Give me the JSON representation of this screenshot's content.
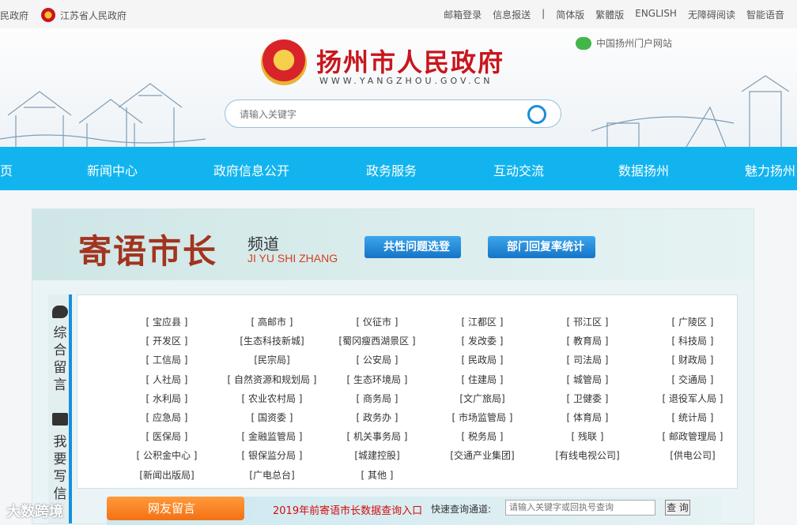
{
  "topbar": {
    "left_link": "民政府",
    "province": "江苏省人民政府",
    "links": [
      "邮箱登录",
      "信息报送",
      "|",
      "简体版",
      "繁體版",
      "ENGLISH",
      "无障碍阅读",
      "智能语音"
    ]
  },
  "header": {
    "title": "扬州市人民政府",
    "url": "WWW.YANGZHOU.GOV.CN",
    "portal": "中国扬州门户网站",
    "search_placeholder": "请输入关键字"
  },
  "nav": [
    "页",
    "新闻中心",
    "政府信息公开",
    "政务服务",
    "互动交流",
    "数据扬州",
    "魅力扬州"
  ],
  "banner": {
    "title": "寄语市长",
    "channel": "频道",
    "channel_en": "JI YU SHI ZHANG",
    "btn1": "共性问题选登",
    "btn2": "部门回复率统计"
  },
  "side": {
    "tab1": "综合留言",
    "tab2": "我要写信"
  },
  "departments": [
    [
      "[ 宝应县 ]",
      "[ 高邮市 ]",
      "[ 仪征市 ]",
      "[ 江都区 ]",
      "[ 邗江区 ]",
      "[ 广陵区 ]"
    ],
    [
      "[ 开发区 ]",
      "[生态科技新城]",
      "[蜀冈瘦西湖景区 ]",
      "[ 发改委 ]",
      "[ 教育局 ]",
      "[ 科技局 ]"
    ],
    [
      "[ 工信局 ]",
      "[民宗局]",
      "[ 公安局 ]",
      "[ 民政局 ]",
      "[ 司法局 ]",
      "[ 财政局 ]"
    ],
    [
      "[ 人社局 ]",
      "[ 自然资源和规划局 ]",
      "[ 生态环境局 ]",
      "[ 住建局 ]",
      "[ 城管局 ]",
      "[ 交通局 ]"
    ],
    [
      "[ 水利局 ]",
      "[ 农业农村局 ]",
      "[ 商务局 ]",
      "[文广旅局]",
      "[ 卫健委 ]",
      "[ 退役军人局 ]"
    ],
    [
      "[ 应急局 ]",
      "[ 国资委 ]",
      "[ 政务办 ]",
      "[ 市场监管局 ]",
      "[ 体育局 ]",
      "[ 统计局 ]"
    ],
    [
      "[ 医保局 ]",
      "[ 金融监管局 ]",
      "[ 机关事务局 ]",
      "[ 税务局 ]",
      "[ 残联 ]",
      "[ 邮政管理局 ]"
    ],
    [
      "[ 公积金中心 ]",
      "[ 银保监分局 ]",
      "[城建控股]",
      "[交通产业集团]",
      "[有线电视公司]",
      "[供电公司]"
    ],
    [
      "[新闻出版局]",
      "[广电总台]",
      "[ 其他 ]"
    ]
  ],
  "bottom": {
    "tab": "网友留言",
    "entry": "2019年前寄语市长数据查询入口",
    "query_label": "快速查询通道:",
    "query_placeholder": "请输入关键字或回执号查询",
    "query_button": "查 询"
  },
  "watermark": "大数跨境"
}
